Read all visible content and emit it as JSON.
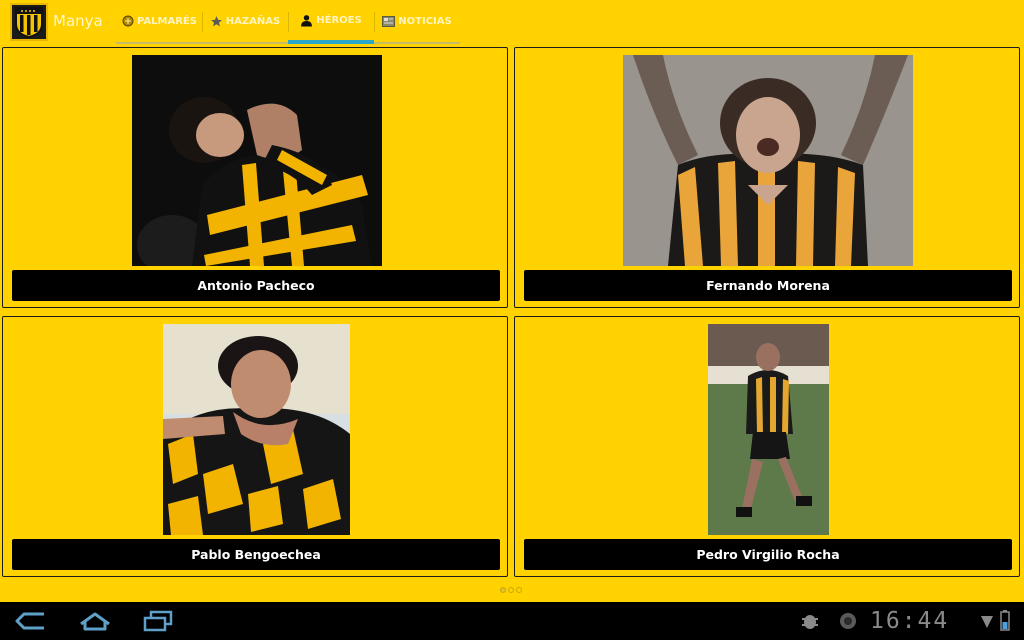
{
  "app": {
    "title": "Manya",
    "logo_icon": "club-shield-icon"
  },
  "tabs": [
    {
      "label": "PALMARÉS",
      "icon": "trophy-icon",
      "active": false
    },
    {
      "label": "HAZAÑAS",
      "icon": "star-icon",
      "active": false
    },
    {
      "label": "HÉROES",
      "icon": "person-icon",
      "active": true
    },
    {
      "label": "NOTICIAS",
      "icon": "newspaper-icon",
      "active": false
    }
  ],
  "heroes": [
    {
      "name": "Antonio Pacheco"
    },
    {
      "name": "Fernando Morena"
    },
    {
      "name": "Pablo Bengoechea"
    },
    {
      "name": "Pedro Virgilio Rocha"
    }
  ],
  "pager": {
    "pages": 3,
    "current": 1
  },
  "system_bar": {
    "time": "16:44"
  },
  "colors": {
    "background": "#FFD200",
    "tab_indicator": "#2aa7c7",
    "name_bar": "#000000",
    "jersey_black": "#111111",
    "jersey_gold": "#f2b400"
  }
}
